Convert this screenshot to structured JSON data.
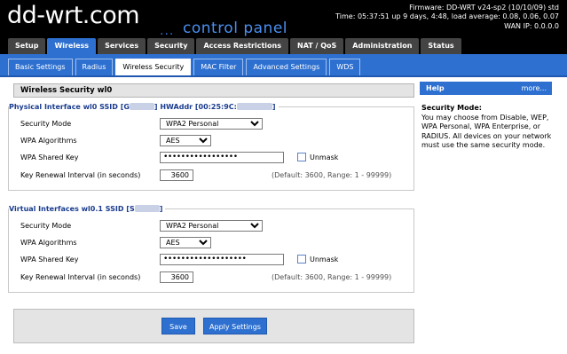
{
  "header": {
    "logo": "dd-wrt",
    "logo_suffix": ".com",
    "tagline_dots": "...",
    "tagline": "control panel",
    "firmware": "Firmware: DD-WRT v24-sp2 (10/10/09) std",
    "time": "Time: 05:37:51 up 9 days, 4:48, load average: 0.08, 0.06, 0.07",
    "wan_ip": "WAN IP: 0.0.0.0"
  },
  "main_tabs": [
    {
      "label": "Setup"
    },
    {
      "label": "Wireless"
    },
    {
      "label": "Services"
    },
    {
      "label": "Security"
    },
    {
      "label": "Access Restrictions"
    },
    {
      "label": "NAT / QoS"
    },
    {
      "label": "Administration"
    },
    {
      "label": "Status"
    }
  ],
  "sub_tabs": [
    {
      "label": "Basic Settings"
    },
    {
      "label": "Radius"
    },
    {
      "label": "Wireless Security"
    },
    {
      "label": "MAC Filter"
    },
    {
      "label": "Advanced Settings"
    },
    {
      "label": "WDS"
    }
  ],
  "page_title": "Wireless Security wl0",
  "physical": {
    "legend_prefix": "Physical Interface wl0 SSID [G",
    "legend_mid": "] HWAddr [00:25:9C:",
    "legend_suffix": "]",
    "security_mode_label": "Security Mode",
    "security_mode_value": "WPA2 Personal",
    "wpa_alg_label": "WPA Algorithms",
    "wpa_alg_value": "AES",
    "shared_key_label": "WPA Shared Key",
    "shared_key_value": "•••••••••••••••••",
    "unmask_label": "Unmask",
    "renewal_label": "Key Renewal Interval (in seconds)",
    "renewal_value": "3600",
    "renewal_hint": "(Default: 3600, Range: 1 - 99999)"
  },
  "virtual": {
    "legend_prefix": "Virtual Interfaces wl0.1 SSID [S",
    "legend_suffix": "]",
    "security_mode_label": "Security Mode",
    "security_mode_value": "WPA2 Personal",
    "wpa_alg_label": "WPA Algorithms",
    "wpa_alg_value": "AES",
    "shared_key_label": "WPA Shared Key",
    "shared_key_value": "•••••••••••••••••••",
    "unmask_label": "Unmask",
    "renewal_label": "Key Renewal Interval (in seconds)",
    "renewal_value": "3600",
    "renewal_hint": "(Default: 3600, Range: 1 - 99999)"
  },
  "buttons": {
    "save": "Save",
    "apply": "Apply Settings"
  },
  "help": {
    "header": "Help",
    "more": "more...",
    "title": "Security Mode:",
    "text": "You may choose from Disable, WEP, WPA Personal, WPA Enterprise, or RADIUS. All devices on your network must use the same security mode."
  },
  "colors": {
    "accent": "#2e70d0",
    "header_bg": "#000000",
    "legend": "#1a3c8f"
  }
}
